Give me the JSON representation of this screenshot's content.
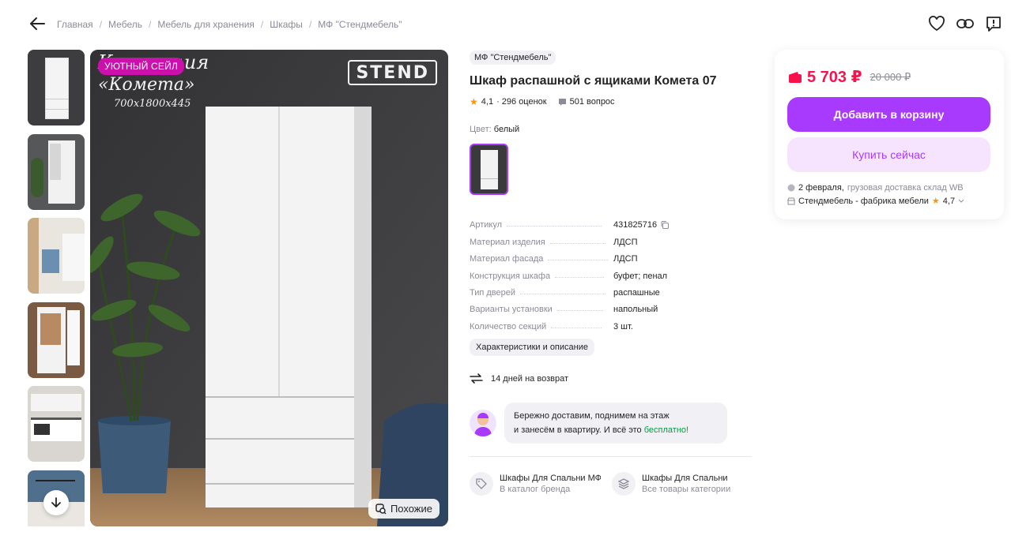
{
  "breadcrumb": [
    "Главная",
    "Мебель",
    "Мебель для хранения",
    "Шкафы",
    "МФ \"Стендмебель\""
  ],
  "gallery": {
    "sale_badge": "УЮТНЫЙ СЕЙЛ",
    "image_title_line1": "Коллекция",
    "image_title_line2": "«Комета»",
    "image_title_line3": "700х1800х445",
    "image_logo": "STEND",
    "similar_label": "Похожие"
  },
  "product": {
    "brand": "МФ \"Стендмебель\"",
    "title": "Шкаф распашной с ящиками Комета 07",
    "rating": "4,1",
    "reviews": "· 296 оценок",
    "questions": "501 вопрос",
    "color_label": "Цвет:",
    "color_value": "белый"
  },
  "specs": [
    {
      "key": "Артикул",
      "value": "431825716"
    },
    {
      "key": "Материал изделия",
      "value": "ЛДСП"
    },
    {
      "key": "Материал фасада",
      "value": "ЛДСП"
    },
    {
      "key": "Конструкция шкафа",
      "value": "буфет; пенал"
    },
    {
      "key": "Тип дверей",
      "value": "распашные"
    },
    {
      "key": "Варианты установки",
      "value": "напольный"
    },
    {
      "key": "Количество секций",
      "value": "3 шт."
    }
  ],
  "chars_button": "Характеристики и описание",
  "return_text": "14 дней на возврат",
  "promo": {
    "line1": "Бережно доставим, поднимем на этаж",
    "line2": "и занесём в квартиру. И всё это",
    "free": "бесплатно!"
  },
  "links": [
    {
      "title": "Шкафы Для Спальни МФ",
      "subtitle": "В каталог бренда"
    },
    {
      "title": "Шкафы Для Спальни",
      "subtitle": "Все товары категории"
    }
  ],
  "price_panel": {
    "price": "5 703 ₽",
    "old_price": "20 000 ₽",
    "add_to_cart": "Добавить в корзину",
    "buy_now": "Купить сейчас",
    "delivery_date": "2 февраля,",
    "delivery_note": "грузовая доставка склад WB",
    "seller": "Стендмебель - фабрика мебели",
    "seller_rating": "4,7"
  },
  "colors": {
    "accent": "#a73afd",
    "price": "#f5134d",
    "sale_badge": "#cb11ab",
    "free": "#00a046"
  }
}
